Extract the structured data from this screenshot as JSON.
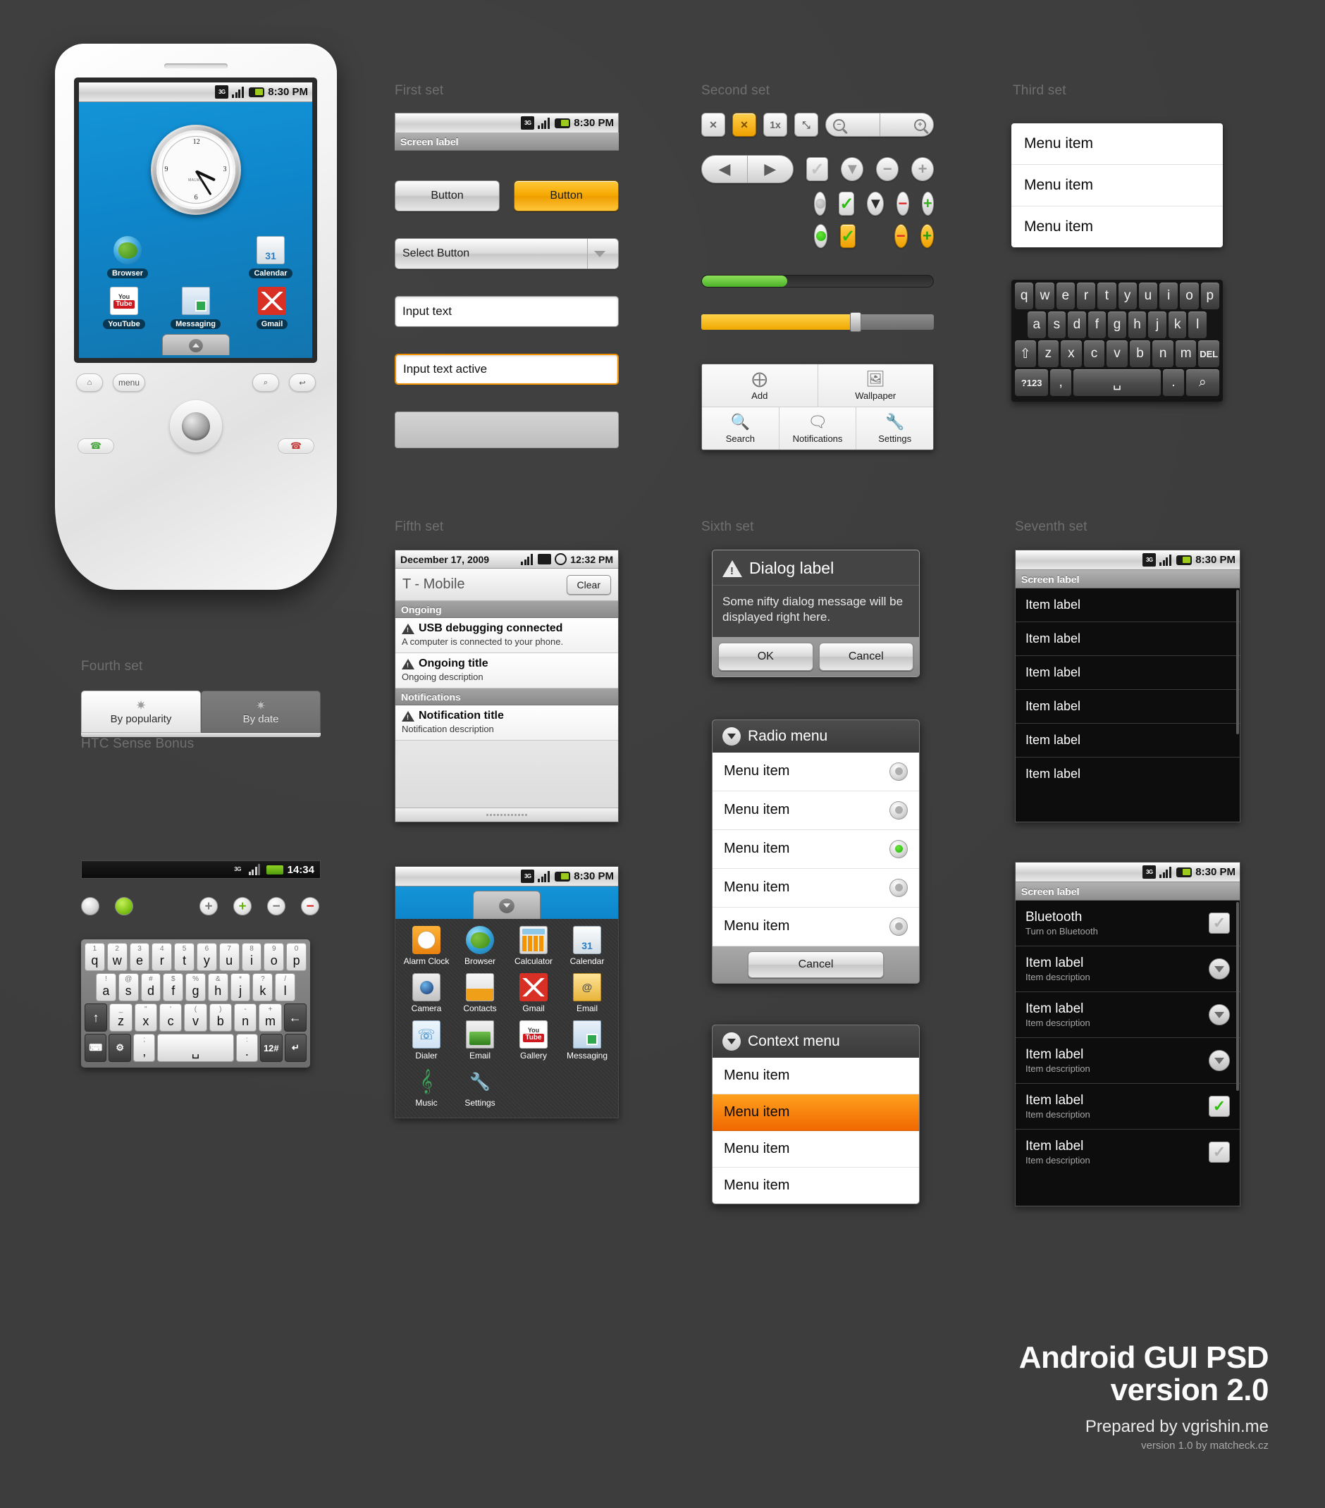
{
  "sections": {
    "first": "First set",
    "second": "Second set",
    "third": "Third set",
    "fourth": "Fourth set",
    "htc_bonus": "HTC Sense Bonus",
    "fifth": "Fifth set",
    "sixth": "Sixth set",
    "seventh": "Seventh set"
  },
  "statusbar": {
    "time": "8:30 PM",
    "network": "3G"
  },
  "phone": {
    "home": {
      "clock_brand": "MALMO",
      "icons": [
        {
          "label": "Browser"
        },
        {
          "label": "Calendar"
        },
        {
          "label": "YouTube"
        },
        {
          "label": "Messaging"
        },
        {
          "label": "Gmail"
        }
      ]
    },
    "hardware_keys": {
      "home": "⌂",
      "menu": "menu",
      "search": "⌕",
      "back": "↩"
    }
  },
  "set1": {
    "screen_label": "Screen label",
    "button_plain": "Button",
    "button_amber": "Button",
    "select_button": "Select Button",
    "input_text": "Input text",
    "input_text_active": "Input text active"
  },
  "set2": {
    "toolbar": [
      {
        "name": "close-button",
        "label": "✕"
      },
      {
        "name": "close-button-active",
        "label": "✕"
      },
      {
        "name": "one-x-button",
        "label": "1x"
      },
      {
        "name": "fullscreen-button",
        "label": "⤡"
      }
    ],
    "zoom_out": "−",
    "zoom_in": "+",
    "nav_back": "◀",
    "nav_forward": "▶",
    "check": "✓",
    "minus": "−",
    "plus": "+",
    "progress_percent": 37,
    "slider_percent": 66,
    "options_menu": [
      {
        "label": "Add",
        "icon": "plus-circle-icon"
      },
      {
        "label": "Wallpaper",
        "icon": "pictures-icon"
      },
      {
        "label": "Search",
        "icon": "search-icon"
      },
      {
        "label": "Notifications",
        "icon": "notification-icon"
      },
      {
        "label": "Settings",
        "icon": "tools-icon"
      }
    ]
  },
  "set3": {
    "menu_items": [
      "Menu item",
      "Menu item",
      "Menu item"
    ],
    "keyboard": {
      "row1": [
        "q",
        "w",
        "e",
        "r",
        "t",
        "y",
        "u",
        "i",
        "o",
        "p"
      ],
      "row2": [
        "a",
        "s",
        "d",
        "f",
        "g",
        "h",
        "j",
        "k",
        "l"
      ],
      "row3": [
        "⇧",
        "z",
        "x",
        "c",
        "v",
        "b",
        "n",
        "m",
        "DEL"
      ],
      "row4": [
        "?123",
        ",",
        "␣",
        ".",
        "⌕"
      ]
    }
  },
  "set4": {
    "tabs": [
      {
        "label": "By popularity",
        "selected": true
      },
      {
        "label": "By date",
        "selected": false
      }
    ],
    "htc_statusbar": {
      "network": "3G",
      "time": "14:34"
    },
    "htc_controls": [
      "radio-off",
      "radio-on-green",
      "plus-gray",
      "plus-green",
      "minus-gray",
      "minus-red"
    ],
    "keyboard": {
      "row1_top": [
        "1",
        "2",
        "3",
        "4",
        "5",
        "6",
        "7",
        "8",
        "9",
        "0"
      ],
      "row1": [
        "q",
        "w",
        "e",
        "r",
        "t",
        "y",
        "u",
        "i",
        "o",
        "p"
      ],
      "row2_top": [
        "!",
        "@",
        "#",
        "$",
        "%",
        "&",
        "*",
        "?",
        "/"
      ],
      "row2": [
        "a",
        "s",
        "d",
        "f",
        "g",
        "h",
        "j",
        "k",
        "l"
      ],
      "row3_top": [
        "_",
        "\"",
        "'",
        "(",
        ")",
        "-",
        "+"
      ],
      "row3": [
        "↑",
        "z",
        "x",
        "c",
        "v",
        "b",
        "n",
        "m",
        "←"
      ],
      "row4": [
        "⌨",
        "⚙",
        ";\n,",
        "␣",
        ":\n.",
        "12#",
        "↵"
      ]
    }
  },
  "set5": {
    "notifications": {
      "date": "December 17, 2009",
      "time": "12:32 PM",
      "carrier": "T - Mobile",
      "clear_label": "Clear",
      "ongoing_header": "Ongoing",
      "notifications_header": "Notifications",
      "items": [
        {
          "title": "USB debugging connected",
          "desc": "A computer is connected to your phone.",
          "group": "ongoing"
        },
        {
          "title": "Ongoing title",
          "desc": "Ongoing description",
          "group": "ongoing"
        },
        {
          "title": "Notification title",
          "desc": "Notification description",
          "group": "notifications"
        }
      ]
    },
    "drawer": {
      "apps": [
        {
          "label": "Alarm Clock",
          "icon": "alarm-clock-icon"
        },
        {
          "label": "Browser",
          "icon": "browser-globe-icon"
        },
        {
          "label": "Calculator",
          "icon": "calculator-icon"
        },
        {
          "label": "Calendar",
          "icon": "calendar-icon"
        },
        {
          "label": "Camera",
          "icon": "camera-icon"
        },
        {
          "label": "Contacts",
          "icon": "contacts-icon"
        },
        {
          "label": "Gmail",
          "icon": "gmail-icon"
        },
        {
          "label": "Email",
          "icon": "email-icon"
        },
        {
          "label": "Dialer",
          "icon": "dialer-icon"
        },
        {
          "label": "Email",
          "icon": "email-photos-icon"
        },
        {
          "label": "Gallery",
          "icon": "youtube-icon"
        },
        {
          "label": "Messaging",
          "icon": "messaging-icon"
        },
        {
          "label": "Music",
          "icon": "music-icon"
        },
        {
          "label": "Settings",
          "icon": "settings-icon"
        }
      ]
    }
  },
  "set6": {
    "dialog": {
      "title": "Dialog label",
      "message": "Some nifty dialog message will be displayed right here.",
      "ok": "OK",
      "cancel": "Cancel"
    },
    "radio_menu": {
      "title": "Radio menu",
      "items": [
        {
          "label": "Menu item",
          "selected": false
        },
        {
          "label": "Menu item",
          "selected": false
        },
        {
          "label": "Menu item",
          "selected": true
        },
        {
          "label": "Menu item",
          "selected": false
        },
        {
          "label": "Menu item",
          "selected": false
        }
      ],
      "cancel": "Cancel"
    },
    "context_menu": {
      "title": "Context menu",
      "items": [
        {
          "label": "Menu item",
          "highlighted": false
        },
        {
          "label": "Menu item",
          "highlighted": true
        },
        {
          "label": "Menu item",
          "highlighted": false
        },
        {
          "label": "Menu item",
          "highlighted": false
        }
      ]
    }
  },
  "set7": {
    "list_simple": {
      "screen_label": "Screen label",
      "time": "8:30 PM",
      "items": [
        "Item label",
        "Item label",
        "Item label",
        "Item label",
        "Item label",
        "Item label"
      ]
    },
    "list_detail": {
      "screen_label": "Screen label",
      "time": "8:30 PM",
      "items": [
        {
          "label": "Bluetooth",
          "desc": "Turn on Bluetooth",
          "control": "checkbox-off"
        },
        {
          "label": "Item label",
          "desc": "Item description",
          "control": "arrow"
        },
        {
          "label": "Item label",
          "desc": "Item description",
          "control": "arrow"
        },
        {
          "label": "Item label",
          "desc": "Item description",
          "control": "arrow"
        },
        {
          "label": "Item label",
          "desc": "Item description",
          "control": "checkbox-on"
        },
        {
          "label": "Item label",
          "desc": "Item description",
          "control": "checkbox-off"
        }
      ]
    }
  },
  "footer": {
    "title_line1": "Android GUI PSD",
    "title_line2": "version 2.0",
    "prepared": "Prepared by vgrishin.me",
    "credit": "version 1.0 by matcheck.cz"
  },
  "colors": {
    "background": "#3d3d3d",
    "accent_amber": "#f0a000",
    "accent_orange": "#f06800",
    "accent_green": "#4bb32a",
    "android_blue": "#1494d8"
  }
}
